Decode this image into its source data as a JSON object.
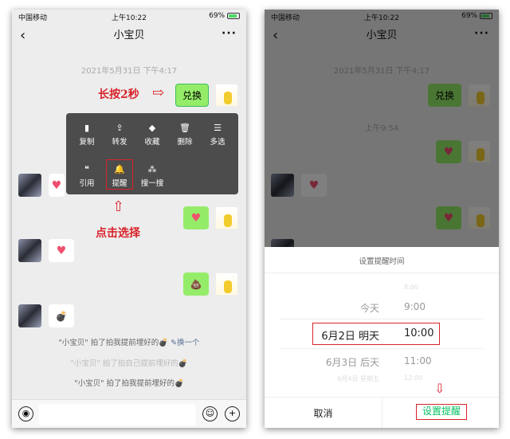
{
  "status": {
    "carrier": "中国移动",
    "time": "上午10:22",
    "battery": "69%"
  },
  "chat": {
    "title": "小宝贝",
    "date": "2021年5月31日 下午4:17",
    "msg_exchange": "兑换",
    "time2": "上午9:54"
  },
  "context_menu": {
    "items": [
      {
        "label": "复制",
        "icon": "file-icon"
      },
      {
        "label": "转发",
        "icon": "share-icon"
      },
      {
        "label": "收藏",
        "icon": "cube-icon"
      },
      {
        "label": "删除",
        "icon": "trash-icon"
      },
      {
        "label": "多选",
        "icon": "list-icon"
      },
      {
        "label": "引用",
        "icon": "quote-icon"
      },
      {
        "label": "提醒",
        "icon": "bell-icon"
      },
      {
        "label": "搜一搜",
        "icon": "sparkle-icon"
      }
    ]
  },
  "annotations": {
    "long_press": "长按2秒",
    "tap_select": "点击选择"
  },
  "system_msgs": {
    "pat1": "\"小宝贝\" 拍了拍我提前埋好的💣",
    "change_one": "换一个",
    "pat2": "\"小宝贝\" 拍了拍自己提前埋好的💣",
    "pat3": "\"小宝贝\" 拍了拍我提前埋好的💣"
  },
  "reminder_sheet": {
    "title": "设置提醒时间",
    "rows": [
      {
        "date": "",
        "time": "8:00"
      },
      {
        "date": "今天",
        "time": "9:00"
      },
      {
        "date": "6月2日 明天",
        "time": "10:00",
        "selected": true
      },
      {
        "date": "6月3日 后天",
        "time": "11:00"
      },
      {
        "date": "6月4日 星期五",
        "time": "12:00"
      }
    ],
    "cancel": "取消",
    "confirm": "设置提醒"
  },
  "colors": {
    "bubble_green": "#95ec69",
    "accent_green": "#07c160",
    "annotation_red": "#d8232a",
    "menu_bg": "#4c4c4c"
  }
}
